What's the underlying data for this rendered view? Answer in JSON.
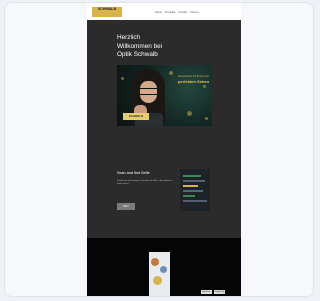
{
  "header": {
    "logo_text": "SCHWALB",
    "nav": [
      "Home",
      "Produkte",
      "Kontakt",
      "Service"
    ]
  },
  "hero": {
    "title_lines": [
      "Herzlich",
      "Willkommen bei",
      "Optik Schwalb"
    ]
  },
  "banner": {
    "text_small": "Gemeinsam mit Ihnen zum",
    "text_highlight": "perfekten Sehen",
    "badge": "SCHWALB"
  },
  "section2": {
    "title": "Scan and find Brille",
    "body": "Finden Sie mit wenigen Schritten die Brille, die perfekt zu Ihnen passt.",
    "button_label": "Mehr"
  },
  "footer": {
    "store_buttons": [
      "App Store",
      "Google Play"
    ]
  },
  "colors": {
    "accent_gold": "#d9b24c",
    "email_bg": "#2b2b2b",
    "footer_bg": "#050505"
  }
}
